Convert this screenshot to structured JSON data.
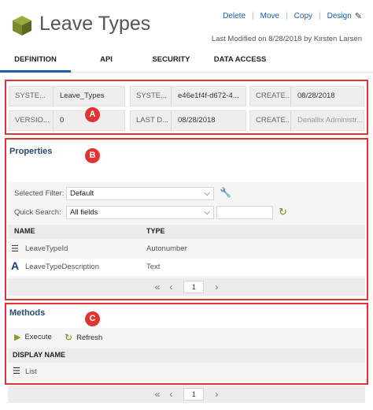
{
  "header": {
    "title": "Leave Types",
    "actions": [
      "Delete",
      "Move",
      "Copy",
      "Design"
    ],
    "modified": "Last Modified on 8/28/2018  by Kirsten Larsen"
  },
  "tabs": [
    "DEFINITION",
    "API",
    "SECURITY",
    "DATA ACCESS"
  ],
  "meta": {
    "row1": [
      {
        "label": "SYSTE...",
        "value": "Leave_Types"
      },
      {
        "label": "SYSTE...",
        "value": "e46e1f4f-d672-4..."
      },
      {
        "label": "CREATE...",
        "value": "08/28/2018"
      }
    ],
    "row2": [
      {
        "label": "VERSIO...",
        "value": "0"
      },
      {
        "label": "LAST D...",
        "value": "08/28/2018"
      },
      {
        "label": "CREATE...",
        "value": "Denallix Administr..."
      }
    ]
  },
  "markers": [
    "A",
    "B",
    "C"
  ],
  "properties": {
    "title": "Properties",
    "selected_filter_label": "Selected Filter:",
    "selected_filter_value": "Default",
    "quick_search_label": "Quick Search:",
    "quick_search_value": "All fields",
    "columns": [
      "NAME",
      "TYPE"
    ],
    "rows": [
      {
        "name": "LeaveTypeId",
        "type": "Autonumber"
      },
      {
        "name": "LeaveTypeDescription",
        "type": "Text"
      }
    ],
    "page": "1"
  },
  "methods": {
    "title": "Methods",
    "execute_label": "Execute",
    "refresh_label": "Refresh",
    "column": "DISPLAY NAME",
    "rows": [
      "List"
    ],
    "page": "1"
  },
  "colors": {
    "accent": "#1b5fa8",
    "annotation_red": "#e03333",
    "logo_green": "#7a8a2e"
  }
}
